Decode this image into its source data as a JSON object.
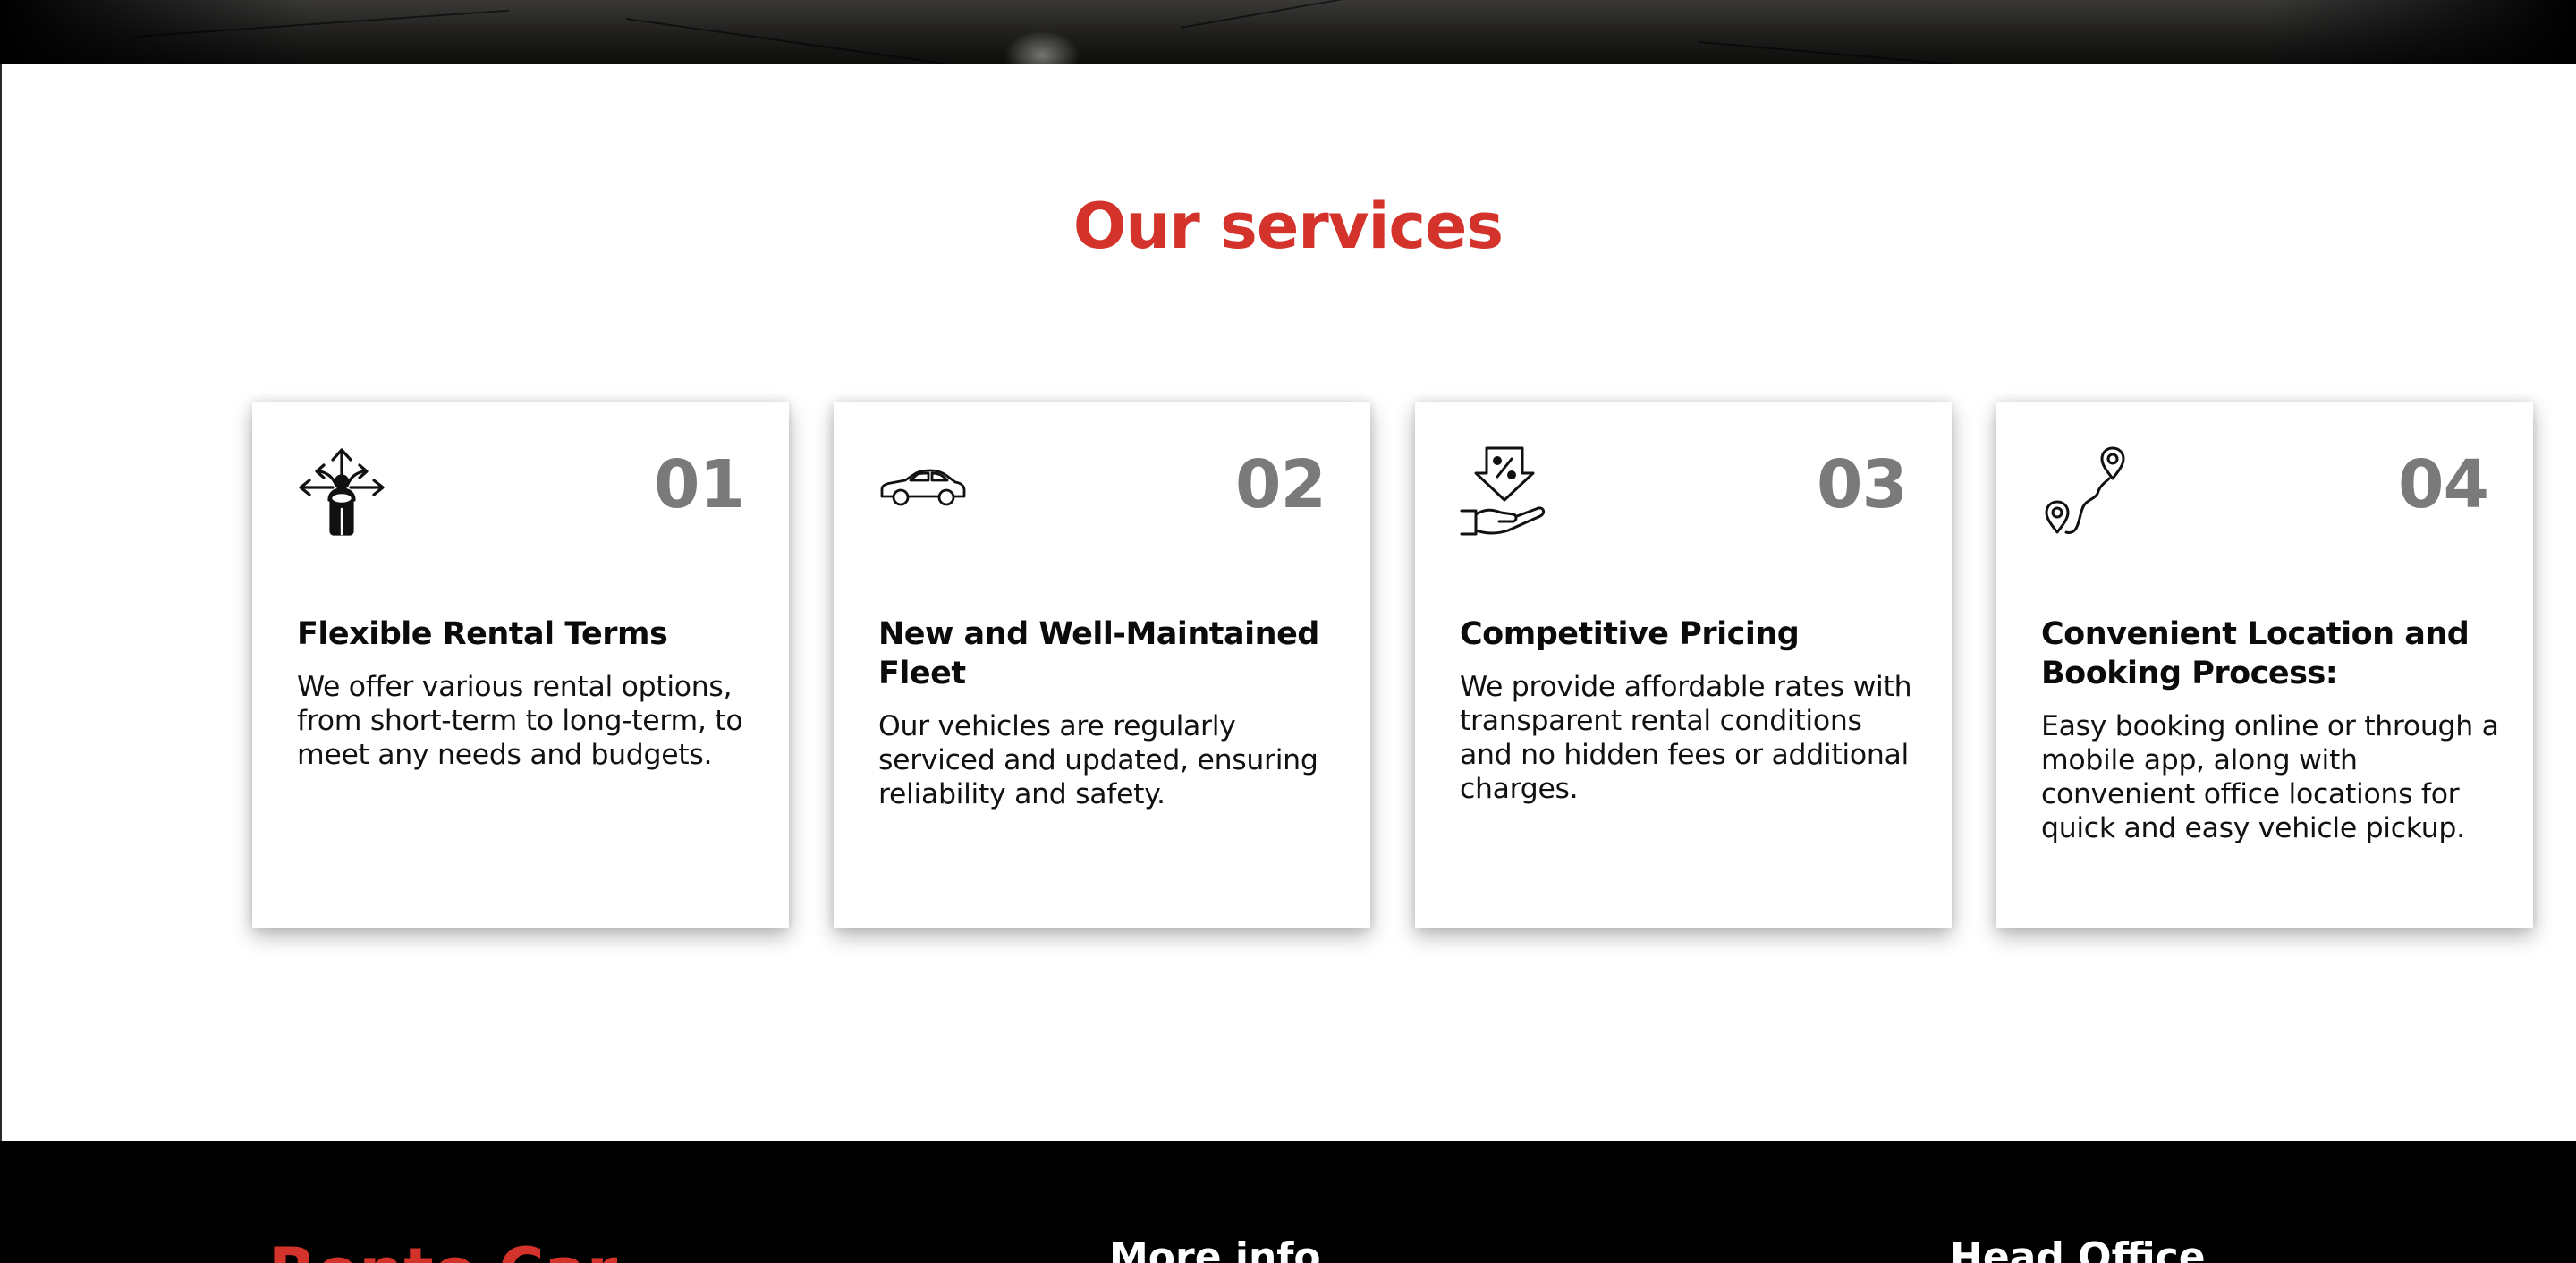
{
  "services": {
    "title": "Our services",
    "cards": [
      {
        "number": "01",
        "icon": "directions-arrows-icon",
        "title": "Flexible Rental Terms",
        "description": "We offer various rental options, from short-term to long-term, to meet any needs and budgets."
      },
      {
        "number": "02",
        "icon": "car-icon",
        "title": "New and Well-Maintained Fleet",
        "description": "Our vehicles are regularly serviced and updated, ensuring reliability and safety."
      },
      {
        "number": "03",
        "icon": "discount-hand-icon",
        "title": "Competitive Pricing",
        "description": "We provide affordable rates with transparent rental conditions and no hidden fees or additional charges."
      },
      {
        "number": "04",
        "icon": "route-pins-icon",
        "title": "Convenient Location and Booking Process:",
        "description": "Easy booking online or through a mobile app, along with convenient office locations for quick and easy vehicle pickup."
      }
    ]
  },
  "footer": {
    "brand": "Rento Car",
    "columns": [
      "More info",
      "Head Office"
    ]
  },
  "colors": {
    "accent": "#d3332a",
    "number_gray": "#7a7a7a",
    "footer_bg": "#000000"
  }
}
